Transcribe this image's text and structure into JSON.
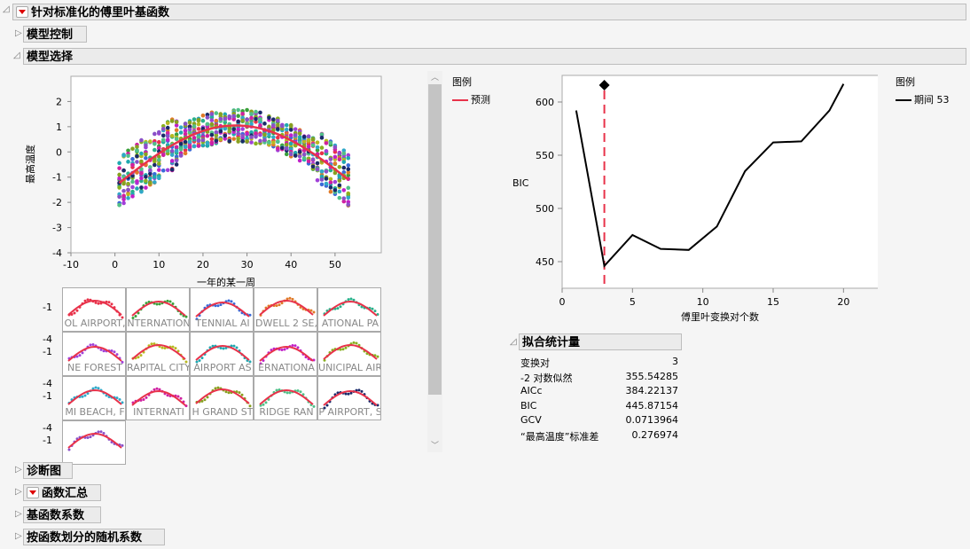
{
  "sections": {
    "main": "针对标准化的傅里叶基函数",
    "model_control": "模型控制",
    "model_select": "模型选择",
    "diag": "诊断图",
    "func_summary": "函数汇总",
    "basis_coef": "基函数系数",
    "random_coef": "按函数划分的随机系数"
  },
  "scatter": {
    "ylabel": "最高温度",
    "xlabel": "一年的某一周",
    "xticks": [
      -10,
      0,
      10,
      20,
      30,
      40,
      50
    ],
    "yticks": [
      2,
      1,
      0,
      -1,
      -2,
      -3,
      -4
    ],
    "legend_title": "图例",
    "legend_item": "预测",
    "pred_color": "#e8324a"
  },
  "small_multiples": {
    "ytick_top": "-1",
    "ytick_bottom": "-4",
    "labels": [
      "OL AIRPORT,",
      "NTERNATION",
      "TENNIAL AI",
      "DWELL 2 SE,",
      "ATIONAL PA",
      "NE FOREST",
      "RAPITAL CITY",
      "AIRPORT AS",
      "ERNATIONA",
      "UNICIPAL AIR",
      "MI BEACH, F",
      "INTERNATI",
      "H GRAND ST",
      "RIDGE RAN",
      "P AIRPORT, S",
      ""
    ],
    "colors": [
      "#e8324a",
      "#3aa03a",
      "#3a6ad8",
      "#e07a28",
      "#2ab08a",
      "#a040d8",
      "#b8b820",
      "#20a8b0",
      "#c020c8",
      "#88b020",
      "#30a8c8",
      "#d020a0",
      "#88a020",
      "#50c088",
      "#1a2a6a",
      "#8a50c8"
    ]
  },
  "chart_data": {
    "type": "line",
    "title": "",
    "xlabel": "傅里叶变换对个数",
    "ylabel": "BIC",
    "xlim": [
      0,
      22.5
    ],
    "ylim": [
      425,
      625
    ],
    "xticks": [
      0,
      5,
      10,
      15,
      20
    ],
    "yticks": [
      450,
      500,
      550,
      600
    ],
    "series": [
      {
        "name": "期间 53",
        "x": [
          1,
          3,
          5,
          7,
          9,
          11,
          13,
          15,
          17,
          19,
          20
        ],
        "y": [
          592,
          446,
          475,
          462,
          461,
          483,
          535,
          562,
          563,
          592,
          617
        ]
      }
    ],
    "selected_x": 3,
    "legend_title": "图例",
    "legend_item": "期间 53"
  },
  "fit_stats": {
    "title": "拟合统计量",
    "rows": [
      [
        "变换对",
        "3"
      ],
      [
        "-2 对数似然",
        "355.54285"
      ],
      [
        "AICc",
        "384.22137"
      ],
      [
        "BIC",
        "445.87154"
      ],
      [
        "GCV",
        "0.0713964"
      ],
      [
        "“最高温度”标准差",
        "0.276974"
      ]
    ]
  }
}
